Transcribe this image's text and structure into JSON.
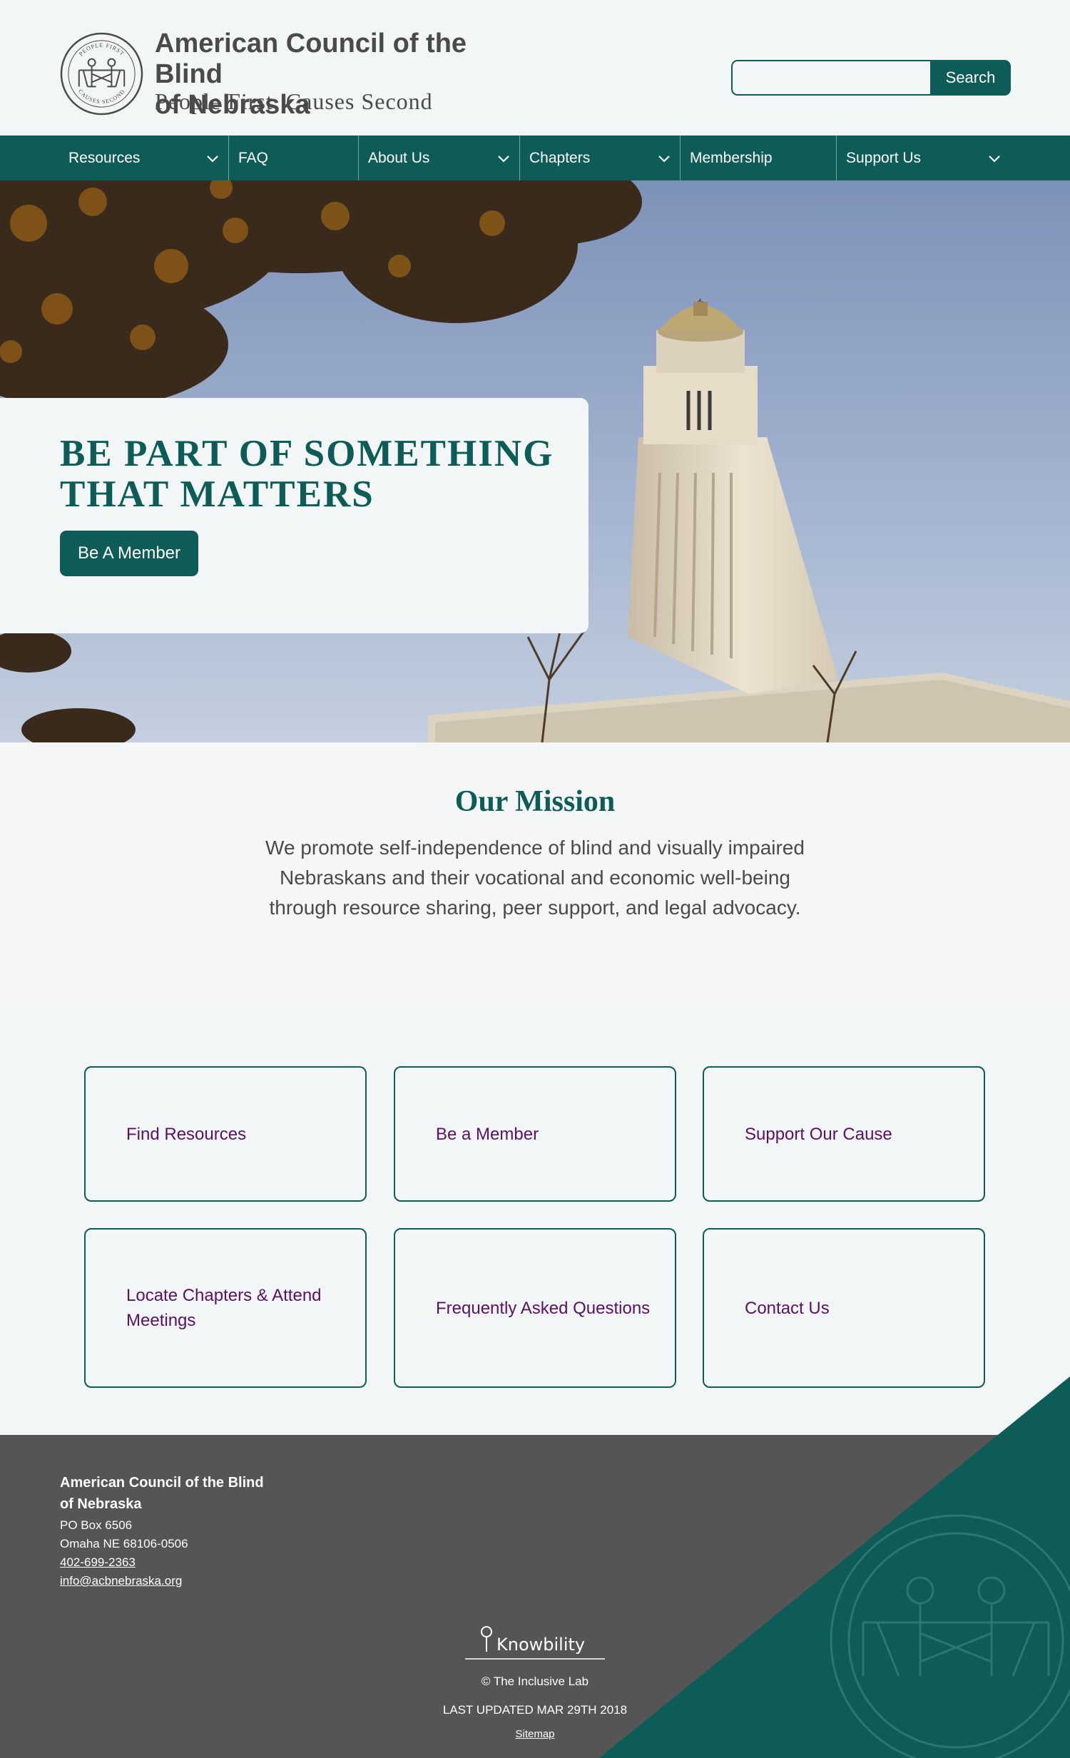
{
  "header": {
    "org_name_line1": "American Council of the Blind",
    "org_name_line2": "of Nebraska",
    "tagline": "People First, Causes Second",
    "logo": {
      "text_top": "PEOPLE FIRST",
      "text_bottom": "CAUSES SECOND",
      "icon": "people-holding-hands-logo-icon"
    },
    "search": {
      "value": "",
      "placeholder": "",
      "button_label": "Search"
    }
  },
  "nav": {
    "items": [
      {
        "label": "Resources",
        "has_dropdown": true
      },
      {
        "label": "FAQ",
        "has_dropdown": false
      },
      {
        "label": "About Us",
        "has_dropdown": true
      },
      {
        "label": "Chapters",
        "has_dropdown": true
      },
      {
        "label": "Membership",
        "has_dropdown": false
      },
      {
        "label": "Support Us",
        "has_dropdown": true
      }
    ]
  },
  "hero": {
    "title": "BE PART OF SOMETHING THAT MATTERS",
    "button_label": "Be A Member",
    "image": "nebraska-state-capitol-photo"
  },
  "mission": {
    "title": "Our Mission",
    "text": "We promote self-independence of blind and visually impaired Nebraskans and their vocational and economic well-being through resource sharing, peer support, and legal advocacy."
  },
  "cards": [
    {
      "label": "Find Resources"
    },
    {
      "label": "Be a Member"
    },
    {
      "label": "Support Our Cause"
    },
    {
      "label": "Locate Chapters & Attend Meetings"
    },
    {
      "label": "Frequently Asked Questions"
    },
    {
      "label": "Contact Us"
    }
  ],
  "footer": {
    "org_name_line1": "American Council of the Blind",
    "org_name_line2": "of Nebraska",
    "address_line1": "PO Box 6506",
    "address_line2": "Omaha NE 68106-0506",
    "phone": "402-699-2363",
    "email": "info@acbnebraska.org",
    "brand": "Knowbility",
    "credit": "© The Inclusive Lab",
    "last_updated": "LAST UPDATED MAR 29TH 2018",
    "sitemap_label": "Sitemap"
  },
  "colors": {
    "brand_teal": "#0d5c57",
    "card_text_purple": "#5b1067",
    "footer_gray": "#555555",
    "background": "#f3f6f7"
  }
}
